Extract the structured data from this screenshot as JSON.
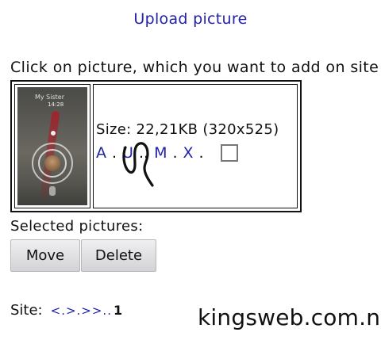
{
  "header": {
    "upload_link": "Upload picture"
  },
  "instruction": "Click on picture, which you want to add on site",
  "picture": {
    "thumbnail_title": "My Sister",
    "thumbnail_time": "14:28",
    "size_text": "Size: 22,21KB (320x525)",
    "actions": [
      "A",
      "U",
      "M",
      "X"
    ],
    "selected": false
  },
  "selection": {
    "label": "Selected pictures:",
    "move_label": "Move",
    "delete_label": "Delete"
  },
  "footer": {
    "site_label": "Site:",
    "pager_links": "<.>.>>..",
    "current_page": "1"
  },
  "watermark": "kingsweb.com.ng",
  "colors": {
    "link": "#2222aa",
    "text": "#111111"
  }
}
